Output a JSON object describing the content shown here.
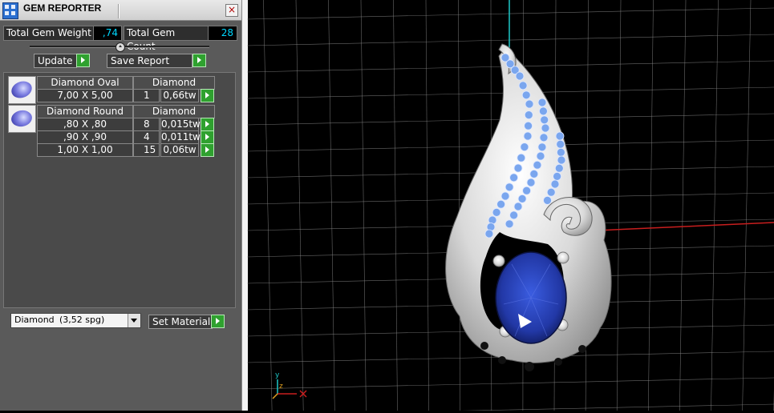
{
  "window": {
    "title": "GEM REPORTER",
    "close_glyph": "×",
    "icon": "gem-reporter-app-icon"
  },
  "stats": {
    "weight_label": "Total Gem Weight",
    "weight_value": ",74",
    "count_label": "Total Gem Count",
    "count_value": "28"
  },
  "toolbar": {
    "update_label": "Update",
    "save_label": "Save Report"
  },
  "gems": {
    "oval": {
      "name": "Diamond Oval",
      "material": "Diamond",
      "rows": [
        {
          "size": "7,00 X 5,00",
          "count": "1",
          "weight": "0,66tw"
        }
      ]
    },
    "round": {
      "name": "Diamond Round",
      "material": "Diamond",
      "rows": [
        {
          "size": ",80 X ,80",
          "count": "8",
          "weight": "0,015tw"
        },
        {
          "size": ",90 X ,90",
          "count": "4",
          "weight": "0,011tw"
        },
        {
          "size": "1,00 X 1,00",
          "count": "15",
          "weight": "0,06tw"
        }
      ]
    }
  },
  "material": {
    "selected_name": "Diamond",
    "selected_gravity": "(3,52 spg)",
    "set_label": "Set Material"
  },
  "viewport": {
    "axis_labels": {
      "y": "y",
      "z": "z"
    },
    "colors": {
      "background": "#000000",
      "grid": "#8a8a8a",
      "x_axis": "#c81e1e",
      "y_axis": "#1ec8c8",
      "metal": "#e6e6e6",
      "sapphire": "#2340b8",
      "accent_stones": "#7aa6ee"
    }
  }
}
